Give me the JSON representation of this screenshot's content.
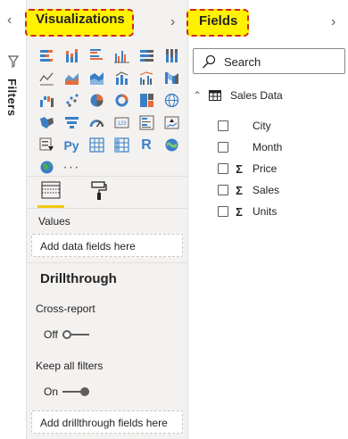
{
  "filters": {
    "label": "Filters"
  },
  "visualizations": {
    "title": "Visualizations",
    "grid": [
      [
        "stacked-bar-icon",
        "stacked-column-icon",
        "clustered-bar-icon",
        "clustered-column-icon",
        "100-percent-bar-icon",
        "100-percent-column-icon"
      ],
      [
        "line-chart-icon",
        "area-chart-icon",
        "stacked-area-icon",
        "line-column-icon",
        "line-clustered-column-icon",
        "ribbon-chart-icon"
      ],
      [
        "waterfall-icon",
        "scatter-icon",
        "pie-chart-icon",
        "donut-chart-icon",
        "treemap-icon",
        "map-icon"
      ],
      [
        "filled-map-icon",
        "funnel-icon",
        "gauge-icon",
        "card-icon",
        "multi-row-card-icon",
        "kpi-icon"
      ],
      [
        "slicer-icon",
        "python-visual-icon",
        "table-icon",
        "matrix-icon",
        "r-visual-icon",
        "arcgis-icon"
      ],
      [
        "globe-icon",
        "more-visuals-icon"
      ]
    ],
    "python_label": "Py",
    "r_label": "R",
    "more_label": "···",
    "tabs": [
      "fields-tab-icon",
      "format-tab-icon"
    ],
    "values_label": "Values",
    "values_well": "Add data fields here",
    "drillthrough_heading": "Drillthrough",
    "cross_report_label": "Cross-report",
    "cross_report_state": "Off",
    "keep_filters_label": "Keep all filters",
    "keep_filters_state": "On",
    "drillthrough_well": "Add drillthrough fields here"
  },
  "fields": {
    "title": "Fields",
    "search_placeholder": "Search",
    "table": {
      "name": "Sales Data",
      "fields": [
        {
          "name": "City",
          "sigma": false
        },
        {
          "name": "Month",
          "sigma": false
        },
        {
          "name": "Price",
          "sigma": true
        },
        {
          "name": "Sales",
          "sigma": true
        },
        {
          "name": "Units",
          "sigma": true
        }
      ]
    },
    "sigma_symbol": "Σ"
  },
  "colors": {
    "highlight_fill": "#fff200",
    "highlight_border": "#d0271d",
    "active_tab": "#f2c811",
    "icon_blue": "#3a7fc6",
    "icon_orange": "#e66c37"
  }
}
